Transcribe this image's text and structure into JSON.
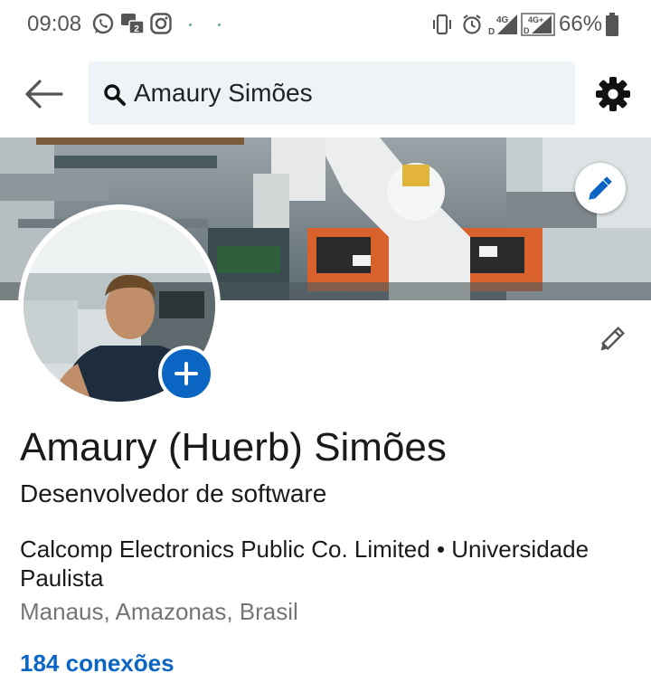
{
  "status_bar": {
    "time": "09:08",
    "left_icons": [
      "whatsapp-icon",
      "message-icon",
      "instagram-icon"
    ],
    "right_icons": [
      "vibrate-icon",
      "alarm-icon",
      "signal-4g-icon",
      "signal-4g-plus-icon",
      "battery-icon"
    ],
    "network_1": "4G",
    "network_2": "4G+",
    "battery": "66%"
  },
  "top_bar": {
    "back_icon": "arrow-left-icon",
    "search_text": "Amaury Simões",
    "settings_icon": "gear-icon"
  },
  "profile": {
    "name": "Amaury (Huerb) Simões",
    "headline": "Desenvolvedor de software",
    "organizations": "Calcomp Electronics Public Co. Limited • Universidade Paulista",
    "location": "Manaus, Amazonas, Brasil",
    "connections": "184 conexões"
  },
  "colors": {
    "accent": "#0a66c2",
    "search_bg": "#eef3f8",
    "text_primary": "#1a1a1a",
    "text_secondary": "#757575"
  }
}
